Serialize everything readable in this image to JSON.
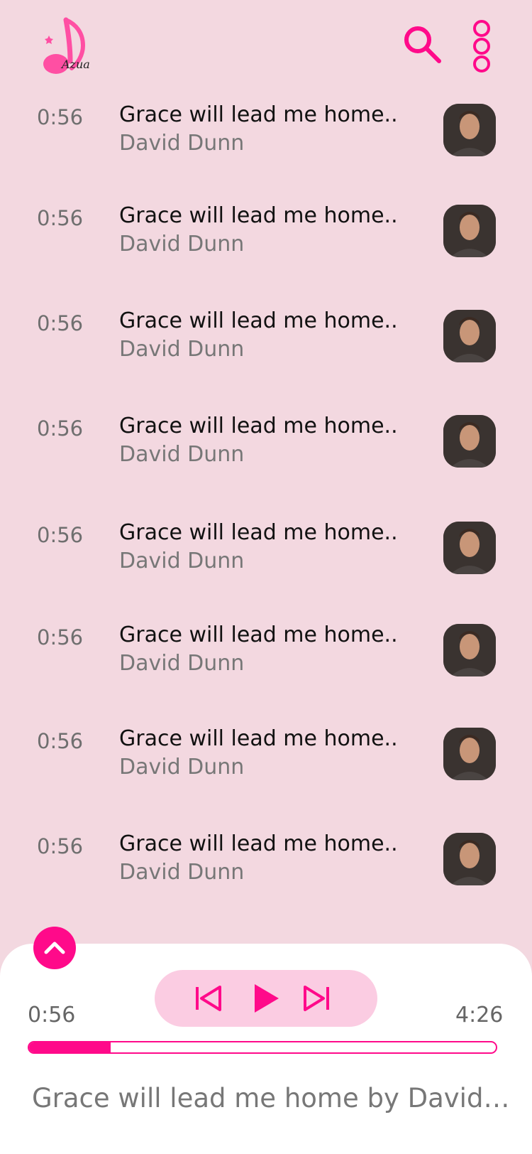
{
  "app": {
    "logo_text": "Azua"
  },
  "colors": {
    "accent": "#ff0a8a",
    "background": "#f3d8e0",
    "controls_bg": "#fbcce2"
  },
  "header": {
    "search_icon": "search-icon",
    "menu_icon": "more-vertical-icon"
  },
  "tracks": [
    {
      "duration": "0:56",
      "title": "Grace will lead me home..",
      "artist": "David Dunn"
    },
    {
      "duration": "0:56",
      "title": "Grace will lead me home..",
      "artist": "David Dunn"
    },
    {
      "duration": "0:56",
      "title": "Grace will lead me home..",
      "artist": "David Dunn"
    },
    {
      "duration": "0:56",
      "title": "Grace will lead me home..",
      "artist": "David Dunn"
    },
    {
      "duration": "0:56",
      "title": "Grace will lead me home..",
      "artist": "David Dunn"
    },
    {
      "duration": "0:56",
      "title": "Grace will lead me home..",
      "artist": "David Dunn"
    },
    {
      "duration": "0:56",
      "title": "Grace will lead me home..",
      "artist": "David Dunn"
    },
    {
      "duration": "0:56",
      "title": "Grace will lead me home..",
      "artist": "David Dunn"
    }
  ],
  "player": {
    "current_time": "0:56",
    "total_time": "4:26",
    "progress": 0.175,
    "now_playing": "Grace will lead me home by David Dunn",
    "icons": [
      "chevron-up-icon",
      "skip-previous-icon",
      "play-icon",
      "skip-next-icon"
    ]
  }
}
